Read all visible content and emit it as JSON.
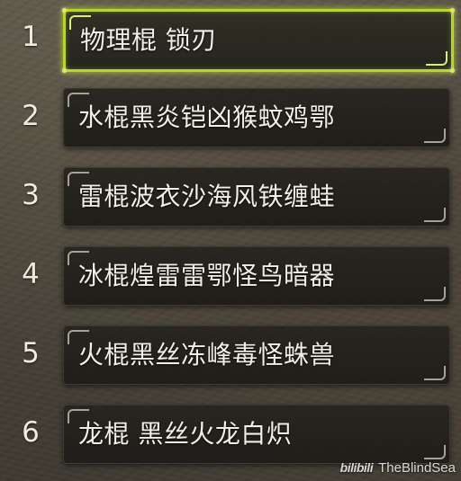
{
  "list": {
    "selected_index": 0,
    "items": [
      {
        "number": "1",
        "label": "物理棍 锁刃"
      },
      {
        "number": "2",
        "label": "水棍黑炎铠凶猴蚊鸡鄂"
      },
      {
        "number": "3",
        "label": "雷棍波衣沙海风铁缠蛙"
      },
      {
        "number": "4",
        "label": "冰棍煌雷雷鄂怪鸟暗器"
      },
      {
        "number": "5",
        "label": "火棍黑丝冻峰毒怪蛛兽"
      },
      {
        "number": "6",
        "label": "龙棍 黑丝火龙白炽"
      }
    ]
  },
  "watermark": {
    "logo": "bilibili",
    "text": "TheBlindSea"
  },
  "colors": {
    "selected_border": "#b8d62a",
    "text": "#f2efe7"
  }
}
